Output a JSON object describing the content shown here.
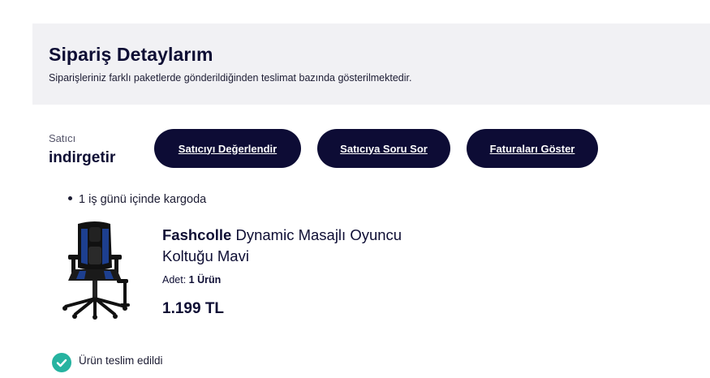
{
  "header": {
    "title": "Sipariş Detaylarım",
    "subtitle": "Siparişleriniz farklı paketlerde gönderildiğinden teslimat bazında gösterilmektedir."
  },
  "seller": {
    "label": "Satıcı",
    "name": "indirgetir"
  },
  "actions": {
    "rate_seller": "Satıcıyı Değerlendir",
    "ask_seller": "Satıcıya Soru Sor",
    "show_invoices": "Faturaları Göster"
  },
  "shipping": {
    "info": "1 iş günü içinde kargoda"
  },
  "product": {
    "brand": "Fashcolle",
    "name": "Dynamic Masajlı Oyuncu Koltuğu Mavi",
    "qty_label": "Adet:",
    "qty_value": "1 Ürün",
    "price": "1.199 TL",
    "image_icon": "gaming-chair-image"
  },
  "status": {
    "text": "Ürün teslim edildi",
    "icon": "check-circle-icon",
    "color": "#26b3a0"
  },
  "colors": {
    "primary": "#0d0c35",
    "header_bg": "#f1f1f4"
  }
}
